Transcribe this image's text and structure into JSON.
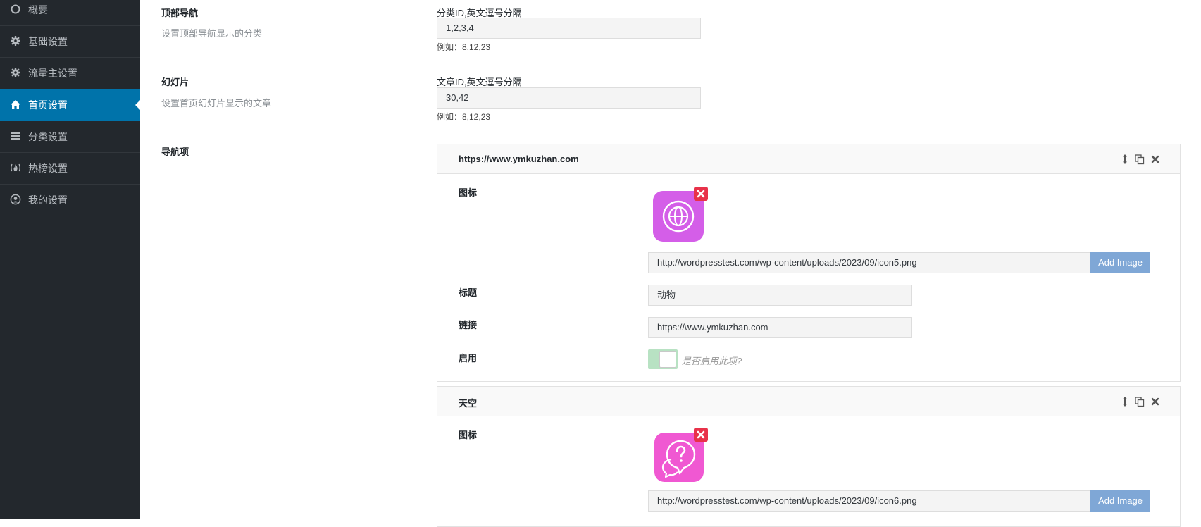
{
  "sidebar": {
    "items": [
      {
        "label": "概要",
        "icon": "circle-icon"
      },
      {
        "label": "基础设置",
        "icon": "gear-icon"
      },
      {
        "label": "流量主设置",
        "icon": "gear-icon"
      },
      {
        "label": "首页设置",
        "icon": "home-icon",
        "active": true
      },
      {
        "label": "分类设置",
        "icon": "list-icon"
      },
      {
        "label": "热榜设置",
        "icon": "fire-icon"
      },
      {
        "label": "我的设置",
        "icon": "user-circle-icon"
      }
    ]
  },
  "sections": {
    "top_nav": {
      "title": "顶部导航",
      "desc": "设置顶部导航显示的分类",
      "field_label": "分类ID,英文逗号分隔",
      "value": "1,2,3,4",
      "hint": "例如：8,12,23"
    },
    "slides": {
      "title": "幻灯片",
      "desc": "设置首页幻灯片显示的文章",
      "field_label": "文章ID,英文逗号分隔",
      "value": "30,42",
      "hint": "例如：8,12,23"
    },
    "nav_items": {
      "title": "导航项",
      "groups": [
        {
          "header": "https://www.ymkuzhan.com",
          "icon_label": "图标",
          "icon_color": "#d45ee8",
          "icon_name": "globe-icon",
          "image_url": "http://wordpresstest.com/wp-content/uploads/2023/09/icon5.png",
          "add_image": "Add Image",
          "title_label": "标题",
          "title_value": "动物",
          "link_label": "链接",
          "link_value": "https://www.ymkuzhan.com",
          "enable_label": "启用",
          "enable_hint": "是否启用此项?",
          "enabled": true
        },
        {
          "header": "天空",
          "icon_label": "图标",
          "icon_color": "#f058d2",
          "icon_name": "question-chat-icon",
          "image_url": "http://wordpresstest.com/wp-content/uploads/2023/09/icon6.png",
          "add_image": "Add Image"
        }
      ]
    }
  },
  "colors": {
    "sidebar_bg": "#23282d",
    "active_bg": "#0073aa",
    "add_button": "#7fa7d6",
    "remove": "#e8324a",
    "toggle_on": "#b8e2c3"
  }
}
